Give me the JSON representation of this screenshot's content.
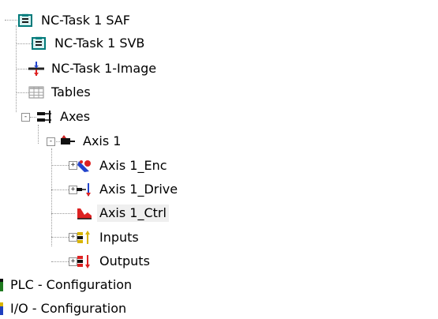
{
  "tree": {
    "nc_task_saf": {
      "label": "NC-Task 1 SAF",
      "icon": "task-icon"
    },
    "nc_task_svb": {
      "label": "NC-Task 1 SVB",
      "icon": "task-icon"
    },
    "nc_task_image": {
      "label": "NC-Task 1-Image",
      "icon": "image-icon"
    },
    "tables": {
      "label": "Tables",
      "icon": "table-icon"
    },
    "axes": {
      "label": "Axes",
      "icon": "axes-icon",
      "toggle": "-"
    },
    "axis1": {
      "label": "Axis 1",
      "icon": "axis-icon",
      "toggle": "-"
    },
    "axis1_enc": {
      "label": "Axis 1_Enc",
      "icon": "encoder-icon",
      "toggle": "+"
    },
    "axis1_drive": {
      "label": "Axis 1_Drive",
      "icon": "drive-icon",
      "toggle": "+"
    },
    "axis1_ctrl": {
      "label": "Axis 1_Ctrl",
      "icon": "controller-icon",
      "selected": true
    },
    "inputs": {
      "label": "Inputs",
      "icon": "inputs-icon",
      "toggle": "+"
    },
    "outputs": {
      "label": "Outputs",
      "icon": "outputs-icon",
      "toggle": "+"
    },
    "plc_config": {
      "label": "PLC - Configuration",
      "icon": "plc-icon"
    },
    "io_config": {
      "label": "I/O - Configuration",
      "icon": "io-icon"
    }
  },
  "colors": {
    "selection": "#efefef",
    "tree_line": "#9a9a9a",
    "plc_bar": "#1f7a1f",
    "io_bar": "#1e3fbf"
  }
}
